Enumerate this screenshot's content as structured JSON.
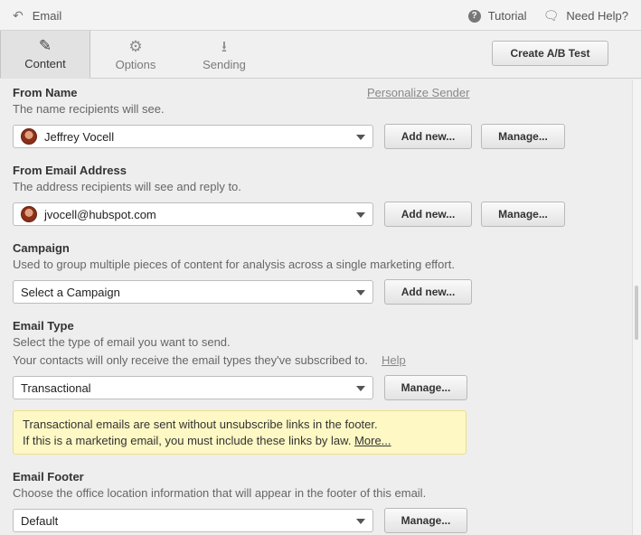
{
  "topbar": {
    "back_label": "Email",
    "tutorial": "Tutorial",
    "help": "Need Help?"
  },
  "tabs": [
    {
      "label": "Content",
      "icon": "pencil-icon"
    },
    {
      "label": "Options",
      "icon": "gear-icon"
    },
    {
      "label": "Sending",
      "icon": "inbox-download-icon"
    }
  ],
  "ab_button": "Create A/B Test",
  "from_name": {
    "title": "From Name",
    "personalize": "Personalize Sender",
    "desc": "The name recipients will see.",
    "value": "Jeffrey Vocell",
    "add_new": "Add new...",
    "manage": "Manage..."
  },
  "from_email": {
    "title": "From Email Address",
    "desc": "The address recipients will see and reply to.",
    "value": "jvocell@hubspot.com",
    "add_new": "Add new...",
    "manage": "Manage..."
  },
  "campaign": {
    "title": "Campaign",
    "desc": "Used to group multiple pieces of content for analysis across a single marketing effort.",
    "value": "Select a Campaign",
    "add_new": "Add new..."
  },
  "email_type": {
    "title": "Email Type",
    "desc1": "Select the type of email you want to send.",
    "desc2": "Your contacts will only receive the email types they've subscribed to.",
    "help": "Help",
    "value": "Transactional",
    "manage": "Manage...",
    "notice_line1": "Transactional emails are sent without unsubscribe links in the footer.",
    "notice_line2": "If this is a marketing email, you must include these links by law.",
    "notice_more": "More..."
  },
  "footer": {
    "title": "Email Footer",
    "desc": "Choose the office location information that will appear in the footer of this email.",
    "value": "Default",
    "manage": "Manage..."
  },
  "colors": {
    "notice_bg": "#fdf8c4",
    "active_tab_bg": "#e2e2e2"
  }
}
